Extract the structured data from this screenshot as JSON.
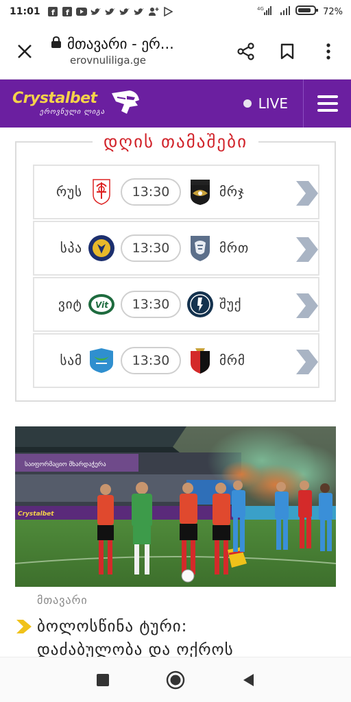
{
  "status_bar": {
    "time": "11:01",
    "network": "4G",
    "battery": "72%",
    "notification_icons": [
      "facebook-icon",
      "facebook-icon",
      "youtube-icon",
      "twitter-icon",
      "twitter-icon",
      "twitter-icon",
      "twitter-icon",
      "add-person-icon",
      "play-store-icon"
    ]
  },
  "browser": {
    "page_title": "მთავარი - ერ...",
    "domain": "erovnuliliga.ge",
    "actions": [
      "close-icon",
      "lock-icon",
      "share-icon",
      "bookmark-icon",
      "more-vert-icon"
    ]
  },
  "header": {
    "brand": "Crystalbet",
    "subtitle": "ეროვნული ლიგა",
    "live_label": "LIVE",
    "colors": {
      "brand_bg": "#6b1fa0",
      "brand_text": "#f5d24a"
    }
  },
  "games": {
    "title": "დღის თამაშები",
    "matches": [
      {
        "home": "რუს",
        "time": "13:30",
        "away": "მრჯ",
        "home_logo": "rustavi-crest-icon",
        "away_logo": "merani-crest-icon"
      },
      {
        "home": "სპა",
        "time": "13:30",
        "away": "მრთ",
        "home_logo": "spaeri-crest-icon",
        "away_logo": "lion-crest-icon"
      },
      {
        "home": "ვიტ",
        "time": "13:30",
        "away": "შუქ",
        "home_logo": "vit-crest-icon",
        "away_logo": "shukura-crest-icon"
      },
      {
        "home": "სამ",
        "time": "13:30",
        "away": "მრმ",
        "home_logo": "samgurali-crest-icon",
        "away_logo": "meshakhte-crest-icon"
      }
    ]
  },
  "news": {
    "category": "მთავარი",
    "title_line1": "ბოლოსწინა ტური:",
    "title_line2": "დაძაბულობა და ოქროს",
    "photo_banner": "საიფორმაციო მხარდაჭერა",
    "ad_text": "Crystalbet"
  },
  "nav": [
    "recents-square-icon",
    "home-circle-icon",
    "back-triangle-icon"
  ]
}
